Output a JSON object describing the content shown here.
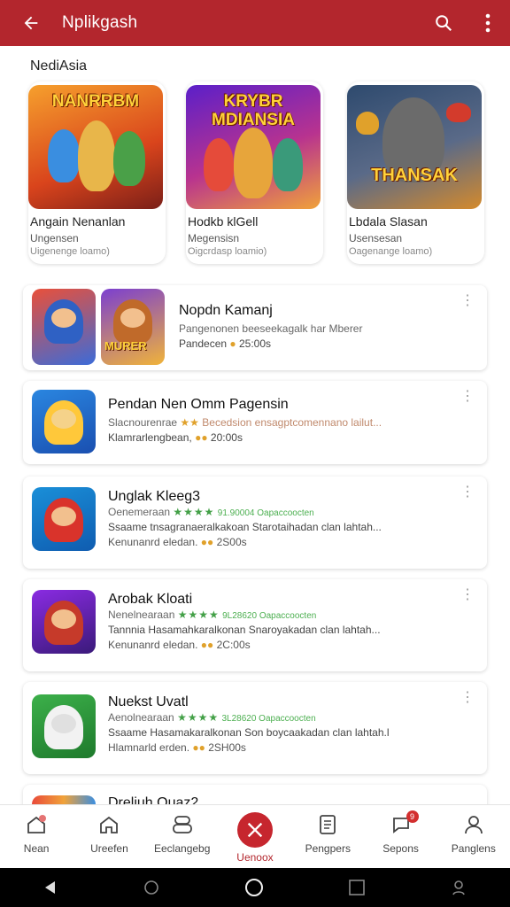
{
  "appbar": {
    "title": "Nplikgash"
  },
  "section": {
    "title": "NediAsia"
  },
  "featured": [
    {
      "art_text": "NANRRBM",
      "name": "Angain Nenanlan",
      "sub": "Ungensen",
      "meta": "Uigenenge loamo)",
      "bg": "#e8561f"
    },
    {
      "art_text": "KRYBR MDIANSIA",
      "name": "Hodkb klGell",
      "sub": "Megensisn",
      "meta": "Oigcrdasp loamio)",
      "bg": "#8b2bd1"
    },
    {
      "art_text": "THANSAK",
      "name": "Lbdala Slasan",
      "sub": "Usensesan",
      "meta": "Oagenange loamo)",
      "bg": "#4a5a7a"
    }
  ],
  "apps": [
    {
      "name": "Nopdn Kamanj",
      "line2": "Pangenonen beeseekagalk har Mberer",
      "line3_pre": "Pandecen",
      "line3_price": "25:00s",
      "badge_text": "MURER"
    },
    {
      "name": "Pendan Nen Omm Pagensin",
      "line2_pre": "Slacnourenrae",
      "line2_stars": "★★",
      "line2_rest": "Becedsion ensagptcomennano lailut...",
      "line3_pre": "Klamrarlengbean,",
      "line3_price": "20:00s"
    },
    {
      "name": "Unglak Kleeg3",
      "line2_pre": "Oenemeraan",
      "line2_stars": "★★★★",
      "line2_rating": "91.90004 Oapaccoocten",
      "line3": "Ssaame tnsagranaeralkakoan Starotaihadan clan lahtah...",
      "line4_pre": "Kenunanrd eledan.",
      "line4_price": "2S00s"
    },
    {
      "name": "Arobak Kloati",
      "line2_pre": "Nenelnearaan",
      "line2_stars": "★★★★",
      "line2_rating": "9L28620 Oapaccoocten",
      "line3": "Tannnia Hasamahkaralkonan Snaroyakadan clan lahtah...",
      "line4_pre": "Kenunanrd eledan.",
      "line4_price": "2C:00s"
    },
    {
      "name": "Nuekst Uvatl",
      "line2_pre": "Aenolnearaan",
      "line2_stars": "★★★★",
      "line2_rating": "3L28620 Oapaccoocten",
      "line3": "Ssaame Hasamakaralkonan Son boycaakadan clan lahtah.l",
      "line4_pre": "Hlamnarld erden.",
      "line4_price": "2SH00s"
    },
    {
      "name": "Dreliuh Ouaz2"
    }
  ],
  "nav": [
    {
      "label": "Nean",
      "icon": "home-badge-icon"
    },
    {
      "label": "Ureefen",
      "icon": "house-icon"
    },
    {
      "label": "Eeclangebg",
      "icon": "controller-icon"
    },
    {
      "label": "Uenoox",
      "icon": "swords-icon"
    },
    {
      "label": "Pengpers",
      "icon": "document-icon"
    },
    {
      "label": "Sepons",
      "icon": "chat-icon",
      "badge": "9"
    },
    {
      "label": "Panglens",
      "icon": "person-icon"
    }
  ],
  "colors": {
    "brand": "#b3262d",
    "accent_green": "#43a047",
    "star_orange": "#e0a12b"
  }
}
